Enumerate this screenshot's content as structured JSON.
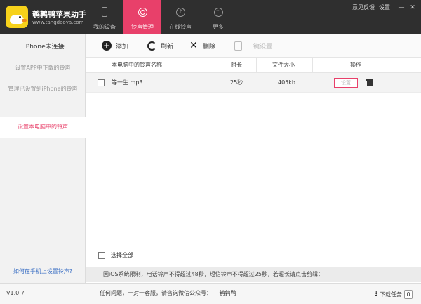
{
  "app": {
    "title": "鹌鹑鸭苹果助手",
    "url": "www.tangdaoya.com",
    "feedback": "意见反馈",
    "settings": "设置",
    "minimize": "—",
    "close": "✕"
  },
  "nav": [
    {
      "label": "我的设备",
      "icon": "phone-icon",
      "active": false
    },
    {
      "label": "铃声管理",
      "icon": "ringtone-icon",
      "active": true
    },
    {
      "label": "在线铃声",
      "icon": "music-note-icon",
      "active": false
    },
    {
      "label": "更多",
      "icon": "more-icon",
      "active": false
    }
  ],
  "sidebar": {
    "status": "iPhone未连接",
    "items": [
      {
        "label": "设置APP中下载的铃声",
        "active": false
      },
      {
        "label": "管理已设置到iPhone的铃声",
        "active": false
      },
      {
        "label": "设置本电脑中的铃声",
        "active": true
      }
    ],
    "help": "如何在手机上设置铃声?"
  },
  "toolbar": {
    "add": "添加",
    "refresh": "刷新",
    "delete": "删除",
    "one_click": "一键设置"
  },
  "table": {
    "headers": {
      "name": "本电脑中的铃声名称",
      "duration": "时长",
      "size": "文件大小",
      "action": "操作"
    },
    "rows": [
      {
        "name": "等一生.mp3",
        "duration": "25秒",
        "size": "405kb",
        "set_label": "设置"
      }
    ],
    "select_all": "选择全部"
  },
  "notice": "因iOS系统限制，电话铃声不得超过48秒，短信铃声不得超过25秒，若超长请点击剪辑：",
  "statusbar": {
    "version": "V1.0.7",
    "contact": "任何问题，一对一客服，请咨询微信公众号：",
    "brand": "鹌鹑鸭",
    "download": "下载任务",
    "download_count": "0"
  },
  "colors": {
    "accent": "#e8406a",
    "topbar": "#2f2f2f",
    "logo": "#f7d21b",
    "link": "#3a6fc4"
  }
}
